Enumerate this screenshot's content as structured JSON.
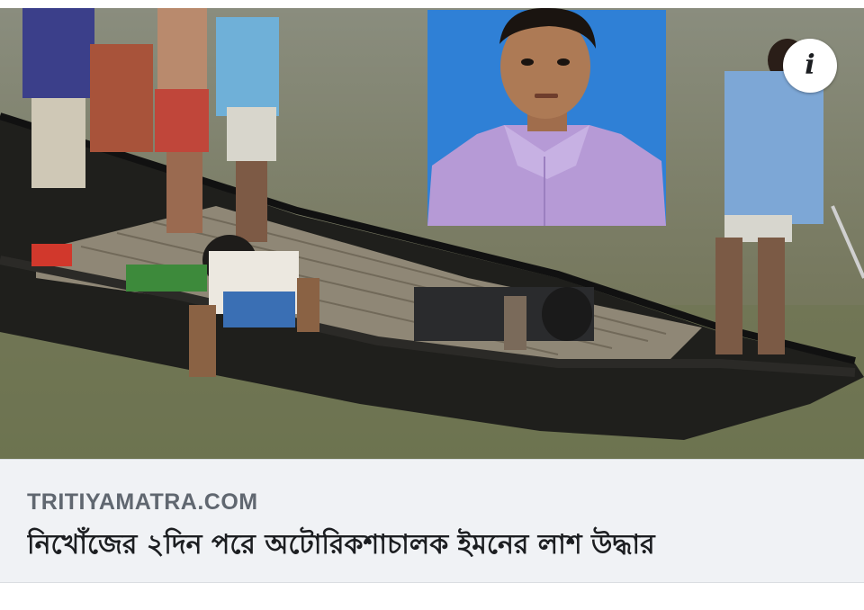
{
  "card": {
    "domain": "TRITIYAMATRA.COM",
    "headline": "নিখোঁজের ২দিন পরে অটোরিকশাচালক ইমনের লাশ উদ্ধার"
  },
  "image": {
    "info_icon": "info-icon"
  }
}
